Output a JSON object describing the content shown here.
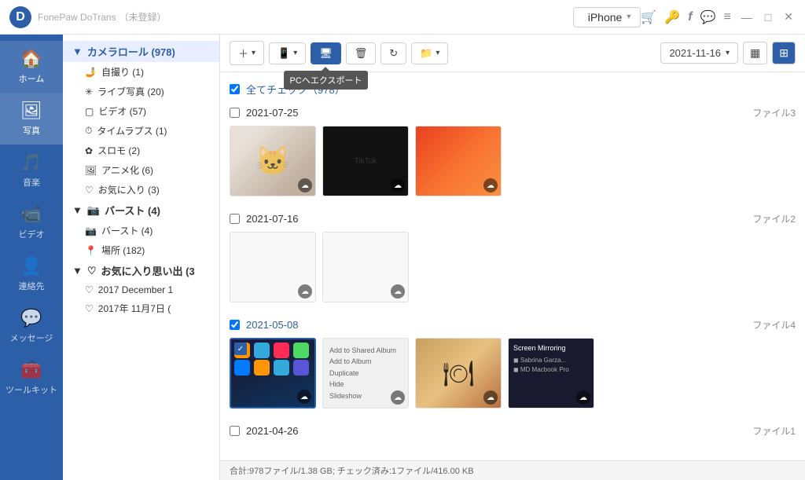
{
  "app": {
    "name": "FonePaw DoTrans",
    "name_suffix": "（未登録）",
    "logo_text": "D"
  },
  "device": {
    "name": "iPhone",
    "icon": ""
  },
  "titlebar_icons": {
    "cart": "🛒",
    "key": "🔑",
    "facebook": "f",
    "chat": "💬",
    "menu": "≡",
    "minimize": "—",
    "restore": "□",
    "close": "✕"
  },
  "nav": {
    "items": [
      {
        "id": "home",
        "label": "ホーム",
        "icon": "🏠"
      },
      {
        "id": "photos",
        "label": "写真",
        "icon": "🖼"
      },
      {
        "id": "music",
        "label": "音楽",
        "icon": "🎵"
      },
      {
        "id": "video",
        "label": "ビデオ",
        "icon": "📹"
      },
      {
        "id": "contacts",
        "label": "連絡先",
        "icon": "👤"
      },
      {
        "id": "messages",
        "label": "メッセージ",
        "icon": "💬"
      },
      {
        "id": "toolkit",
        "label": "ツールキット",
        "icon": "🧰"
      }
    ],
    "active": "photos"
  },
  "tree": {
    "items": [
      {
        "id": "camera-roll",
        "label": "カメラロール (978)",
        "level": 0,
        "type": "folder",
        "expanded": true,
        "selected": true
      },
      {
        "id": "selfie",
        "label": "自撮り (1)",
        "level": 1,
        "icon": "🤳"
      },
      {
        "id": "live",
        "label": "ライブ写真 (20)",
        "level": 1,
        "icon": "✳"
      },
      {
        "id": "video",
        "label": "ビデオ (57)",
        "level": 1,
        "icon": "▢"
      },
      {
        "id": "timelapse",
        "label": "タイムラプス (1)",
        "level": 1,
        "icon": "⏱"
      },
      {
        "id": "slowmo",
        "label": "スロモ (2)",
        "level": 1,
        "icon": "✿"
      },
      {
        "id": "anime",
        "label": "アニメ化 (6)",
        "level": 1,
        "icon": "🖼"
      },
      {
        "id": "favorites",
        "label": "お気に入り (3)",
        "level": 1,
        "icon": "♡"
      },
      {
        "id": "burst",
        "label": "バースト (4)",
        "level": 0,
        "type": "folder",
        "expanded": true,
        "arrow": "▼"
      },
      {
        "id": "burst-sub",
        "label": "バースト (4)",
        "level": 1,
        "icon": "📷"
      },
      {
        "id": "places",
        "label": "場所 (182)",
        "level": 1,
        "icon": "📍"
      },
      {
        "id": "fav-memories",
        "label": "お気に入り思い出 (3",
        "level": 0,
        "type": "folder",
        "expanded": true,
        "arrow": "▼"
      },
      {
        "id": "mem-2017dec",
        "label": "2017 December 1",
        "level": 1,
        "icon": "♡"
      },
      {
        "id": "mem-2017nov",
        "label": "2017年 11月7日 (",
        "level": 1,
        "icon": "♡"
      }
    ]
  },
  "toolbar": {
    "add_label": "+",
    "to_device_label": "📱",
    "export_pc_label": "🖥",
    "delete_label": "🗑",
    "refresh_label": "↻",
    "folder_label": "📁",
    "export_tooltip": "PCへエクスポート",
    "date_value": "2021-11-16",
    "view_grid_dense": "▦",
    "view_grid": "⊞"
  },
  "gallery": {
    "check_all_label": "全てチェック（978）",
    "check_all_checked": true,
    "sections": [
      {
        "id": "2021-07-25",
        "date": "2021-07-25",
        "files_label": "ファイル3",
        "checked": false,
        "thumbs": [
          {
            "id": "t1",
            "type": "fluffy",
            "has_cloud": true,
            "selected": false
          },
          {
            "id": "t2",
            "type": "black",
            "has_cloud": true,
            "selected": false
          },
          {
            "id": "t3",
            "type": "orange",
            "has_cloud": true,
            "selected": false
          }
        ]
      },
      {
        "id": "2021-07-16",
        "date": "2021-07-16",
        "files_label": "ファイル2",
        "checked": false,
        "thumbs": [
          {
            "id": "t4",
            "type": "empty",
            "has_cloud": true,
            "selected": false
          },
          {
            "id": "t5",
            "type": "empty",
            "has_cloud": true,
            "selected": false
          }
        ]
      },
      {
        "id": "2021-05-08",
        "date": "2021-05-08",
        "files_label": "ファイル4",
        "checked": true,
        "thumbs": [
          {
            "id": "t6",
            "type": "ios",
            "has_cloud": true,
            "selected": true
          },
          {
            "id": "t7",
            "type": "menu",
            "has_cloud": true,
            "selected": false
          },
          {
            "id": "t8",
            "type": "food",
            "has_cloud": true,
            "selected": false
          },
          {
            "id": "t9",
            "type": "screen",
            "has_cloud": true,
            "selected": false
          }
        ]
      },
      {
        "id": "2021-04-26",
        "date": "2021-04-26",
        "files_label": "ファイル1",
        "checked": false,
        "thumbs": []
      }
    ]
  },
  "statusbar": {
    "text": "合計:978ファイル/1.38 GB; チェック済み:1ファイル/416.00 KB"
  }
}
